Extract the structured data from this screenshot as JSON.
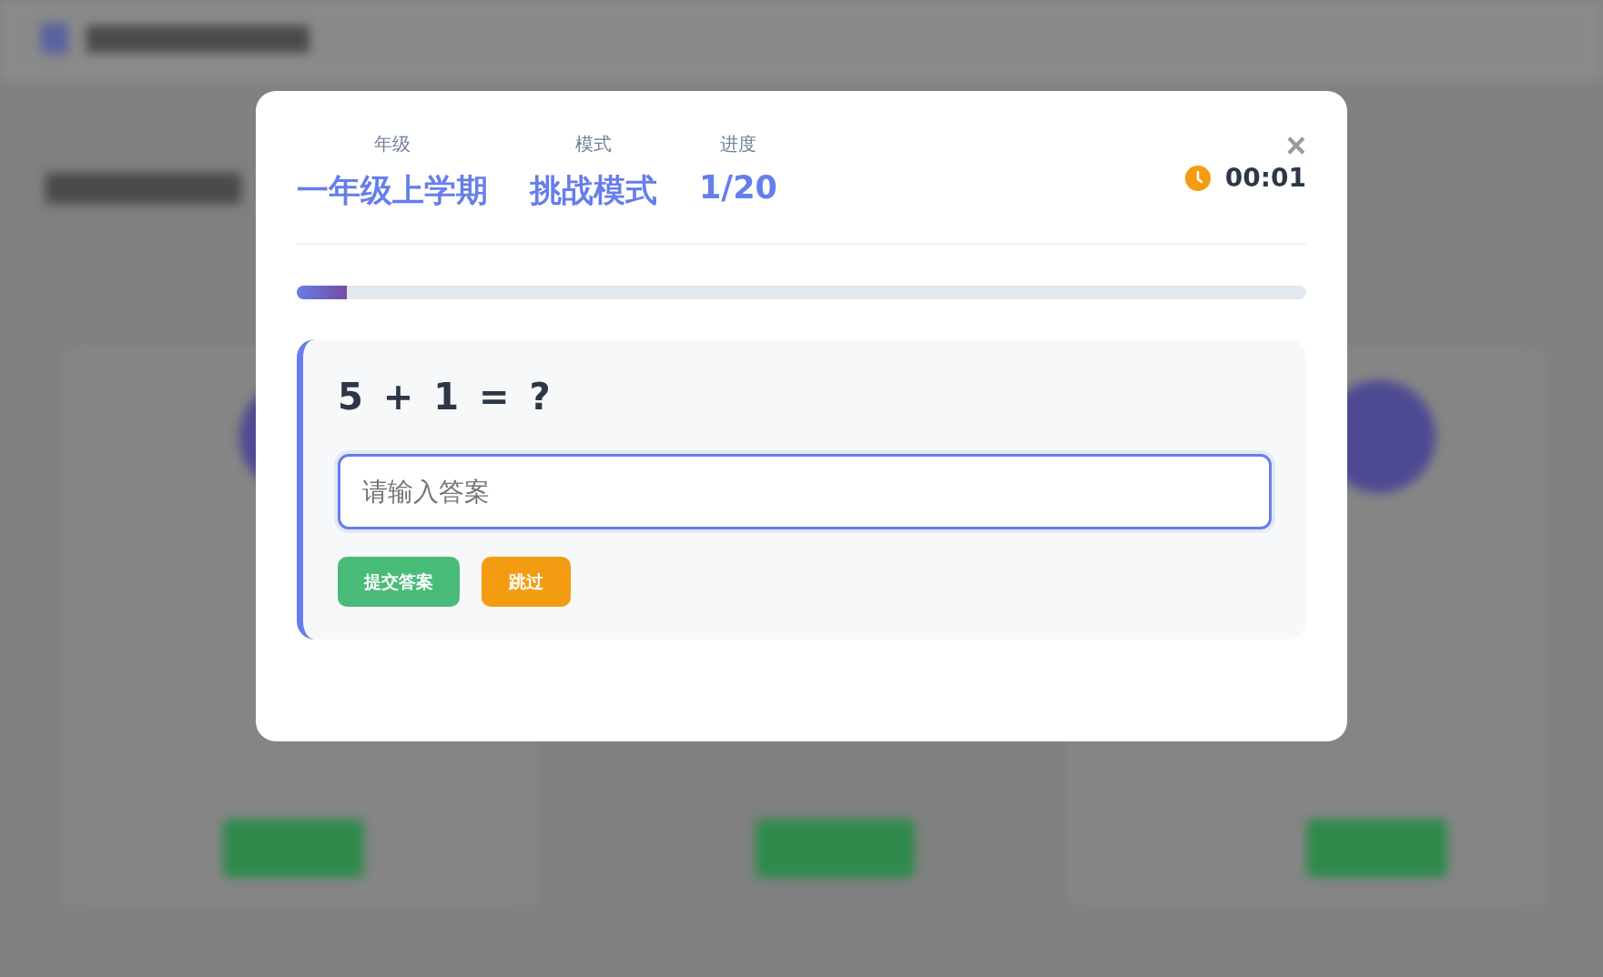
{
  "header": {
    "stats": [
      {
        "label": "年级",
        "value": "一年级上学期"
      },
      {
        "label": "模式",
        "value": "挑战模式"
      },
      {
        "label": "进度",
        "value": "1/20"
      }
    ],
    "timer": "00:01",
    "close": "×"
  },
  "progress": {
    "level": 0.05
  },
  "question": {
    "text": "5 + 1 = ?",
    "answer": {
      "placeholder": "请输入答案"
    },
    "buttons": [
      {
        "label": "提交答案",
        "kind": "primary"
      },
      {
        "label": "跳过",
        "kind": "secondary"
      }
    ]
  }
}
